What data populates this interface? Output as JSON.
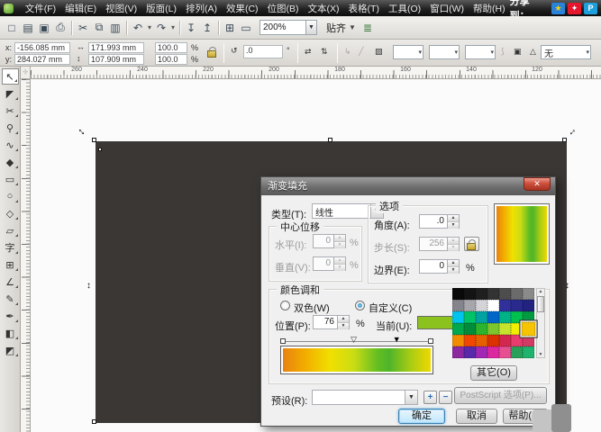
{
  "menubar": {
    "items": [
      "文件(F)",
      "编辑(E)",
      "视图(V)",
      "版面(L)",
      "排列(A)",
      "效果(C)",
      "位图(B)",
      "文本(X)",
      "表格(T)",
      "工具(O)",
      "窗口(W)",
      "帮助(H)"
    ],
    "share_label": "分享到：",
    "share_icons": [
      {
        "name": "qzone-icon",
        "glyph": "★",
        "bg": "#2b82d9",
        "fg": "#ffd400"
      },
      {
        "name": "weibo-icon",
        "glyph": "✦",
        "bg": "#e6162d",
        "fg": "#ffffff"
      },
      {
        "name": "baidu-icon",
        "glyph": "P",
        "bg": "#1e9fdb",
        "fg": "#ffffff"
      }
    ]
  },
  "toolbar": {
    "items": [
      {
        "name": "new-button",
        "glyph": "□",
        "cls": ""
      },
      {
        "name": "open-button",
        "glyph": "▤",
        "cls": ""
      },
      {
        "name": "save-button",
        "glyph": "▣",
        "cls": ""
      },
      {
        "name": "print-button",
        "glyph": "⎙",
        "cls": ""
      },
      {
        "name": "separator",
        "glyph": "",
        "cls": "sep"
      },
      {
        "name": "cut-button",
        "glyph": "✂",
        "cls": ""
      },
      {
        "name": "copy-button",
        "glyph": "⧉",
        "cls": ""
      },
      {
        "name": "paste-button",
        "glyph": "▥",
        "cls": ""
      },
      {
        "name": "separator",
        "glyph": "",
        "cls": "sep"
      },
      {
        "name": "undo-button",
        "glyph": "↶",
        "cls": ""
      },
      {
        "name": "undo-dropdown",
        "glyph": "▾",
        "cls": "caret"
      },
      {
        "name": "redo-button",
        "glyph": "↷",
        "cls": ""
      },
      {
        "name": "redo-dropdown",
        "glyph": "▾",
        "cls": "caret"
      },
      {
        "name": "separator",
        "glyph": "",
        "cls": "sep"
      },
      {
        "name": "import-button",
        "glyph": "↧",
        "cls": ""
      },
      {
        "name": "export-button",
        "glyph": "↥",
        "cls": ""
      },
      {
        "name": "separator",
        "glyph": "",
        "cls": "sep"
      },
      {
        "name": "app-launcher-button",
        "glyph": "⊞",
        "cls": ""
      },
      {
        "name": "welcome-screen-button",
        "glyph": "▭",
        "cls": ""
      }
    ],
    "zoom_value": "200%",
    "snap_label": "贴齐",
    "options_glyph": "≣"
  },
  "propbar": {
    "x_label": "x:",
    "x_value": "-156.085 mm",
    "y_label": "y:",
    "y_value": "284.027 mm",
    "width_icon": "↔",
    "width_value": "171.993 mm",
    "height_icon": "↕",
    "height_value": "107.909 mm",
    "scale_x": "100.0",
    "scale_y": "100.0",
    "percent": "%",
    "rotate_icon": "↺",
    "angle_value": ".0",
    "degree": "°",
    "mirror_h_icon": "⇄",
    "mirror_v_icon": "⇅",
    "outline_value": "无"
  },
  "toolbox": {
    "tools": [
      {
        "name": "pick-tool",
        "glyph": "↖",
        "cls": "active"
      },
      {
        "name": "shape-tool",
        "glyph": "◤",
        "cls": ""
      },
      {
        "name": "crop-tool",
        "glyph": "✂",
        "cls": ""
      },
      {
        "name": "zoom-tool",
        "glyph": "⚲",
        "cls": ""
      },
      {
        "name": "freehand-tool",
        "glyph": "∿",
        "cls": ""
      },
      {
        "name": "smart-fill-tool",
        "glyph": "◆",
        "cls": ""
      },
      {
        "name": "rectangle-tool",
        "glyph": "▭",
        "cls": ""
      },
      {
        "name": "ellipse-tool",
        "glyph": "○",
        "cls": ""
      },
      {
        "name": "polygon-tool",
        "glyph": "◇",
        "cls": ""
      },
      {
        "name": "basic-shapes-tool",
        "glyph": "▱",
        "cls": ""
      },
      {
        "name": "text-tool",
        "glyph": "字",
        "cls": ""
      },
      {
        "name": "table-tool",
        "glyph": "⊞",
        "cls": ""
      },
      {
        "name": "dimension-tool",
        "glyph": "∠",
        "cls": ""
      },
      {
        "name": "eyedropper-tool",
        "glyph": "✎",
        "cls": ""
      },
      {
        "name": "outline-pen-tool",
        "glyph": "✒",
        "cls": ""
      },
      {
        "name": "fill-tool",
        "glyph": "◧",
        "cls": ""
      },
      {
        "name": "interactive-fill-tool",
        "glyph": "◩",
        "cls": ""
      }
    ]
  },
  "ruler": {
    "h_numbers": [
      {
        "label": "260",
        "x": "51"
      },
      {
        "label": "240",
        "x": "124"
      },
      {
        "label": "220",
        "x": "197"
      },
      {
        "label": "200",
        "x": "270"
      },
      {
        "label": "180",
        "x": "343"
      },
      {
        "label": "160",
        "x": "416"
      },
      {
        "label": "140",
        "x": "489"
      },
      {
        "label": "120",
        "x": "562"
      }
    ]
  },
  "dialog": {
    "title": "渐变填充",
    "close_glyph": "✕",
    "type_label": "类型(T):",
    "type_value": "线性",
    "options_label": "选项",
    "angle_label": "角度(A):",
    "angle_value": ".0",
    "steps_label": "步长(S):",
    "steps_value": "256",
    "edge_label": "边界(E):",
    "edge_value": "0",
    "center_label": "中心位移",
    "horizontal_label": "水平(I):",
    "horizontal_value": "0",
    "vertical_label": "垂直(V):",
    "vertical_value": "0",
    "percent": "%",
    "blend_label": "颜色调和",
    "two_color_label": "双色(W)",
    "custom_label": "自定义(C)",
    "position_label": "位置(P):",
    "position_value": "76",
    "current_label": "当前(U):",
    "current_color": "#8cc21e",
    "others_label": "其它(O)",
    "presets_label": "预设(R):",
    "presets_value": "",
    "add_label": "+",
    "remove_label": "−",
    "postscript_label": "PostScript 选项(P)...",
    "ok_label": "确定",
    "cancel_label": "取消",
    "help_label": "帮助(H)",
    "gradient_stops": [
      {
        "pos": 0,
        "color": "#e8820f"
      },
      {
        "pos": 14,
        "color": "#f2aa00"
      },
      {
        "pos": 32,
        "color": "#f0e000"
      },
      {
        "pos": 48,
        "color": "#cadc14"
      },
      {
        "pos": 64,
        "color": "#64be22"
      },
      {
        "pos": 72,
        "color": "#4fb42a"
      },
      {
        "pos": 86,
        "color": "#a6cc14"
      },
      {
        "pos": 100,
        "color": "#f0d800"
      }
    ],
    "marker_positions": {
      "start": 0,
      "mid": 48,
      "selected": 76,
      "end": 100
    },
    "palette_colors": [
      "#0a0a0a",
      "#141414",
      "#1f1f1f",
      "#333333",
      "#4d4d4d",
      "#6b6b6b",
      "#8a8a8a",
      "#84848c",
      "#a6a6ac",
      "#d4d4d8",
      "#ffffff",
      "#30309a",
      "#2a2a8e",
      "#222280",
      "#00c4ee",
      "#00c266",
      "#00a2a2",
      "#0066c8",
      "#00b286",
      "#00c04e",
      "#009a40",
      "#00a84e",
      "#008c3a",
      "#2cb42c",
      "#7cc62e",
      "#c6e42e",
      "#f2ee00",
      "#f6c400",
      "#f28c00",
      "#f04800",
      "#e66000",
      "#dc3200",
      "#d22850",
      "#e63c6e",
      "#d23c64",
      "#8c28a0",
      "#5a28aa",
      "#a028b4",
      "#dc28a0",
      "#e65090",
      "#28a05a",
      "#1eb46e"
    ],
    "palette_selected_index": 27
  }
}
